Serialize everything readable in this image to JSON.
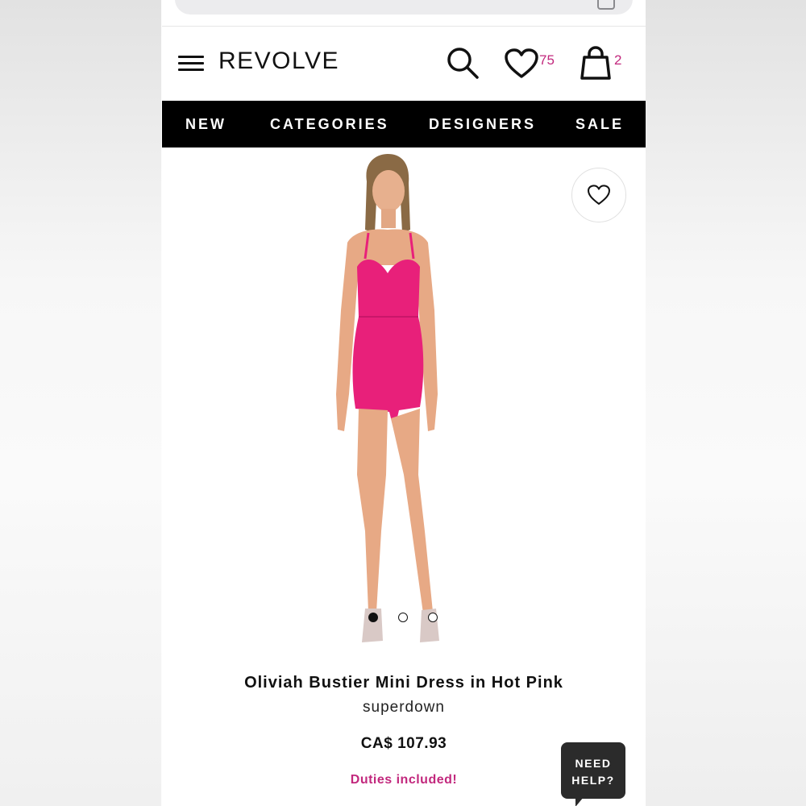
{
  "header": {
    "logo": "REVOLVE",
    "wishlist_count": "75",
    "bag_count": "2"
  },
  "nav": {
    "items": [
      "NEW",
      "CATEGORIES",
      "DESIGNERS",
      "SALE"
    ]
  },
  "product": {
    "title": "Oliviah Bustier Mini Dress in Hot Pink",
    "brand": "superdown",
    "price": "CA$ 107.93",
    "duties_note": "Duties included!",
    "image_count": 3,
    "active_image": 1
  },
  "chat": {
    "label": "NEED\nHELP?"
  },
  "icons": {
    "menu": "hamburger-menu-icon",
    "search": "search-icon",
    "wishlist": "heart-icon",
    "bag": "shopping-bag-icon",
    "favorite": "heart-outline-icon"
  },
  "colors": {
    "accent": "#c2287d",
    "nav_bg": "#000000",
    "dress": "#e8207a"
  }
}
